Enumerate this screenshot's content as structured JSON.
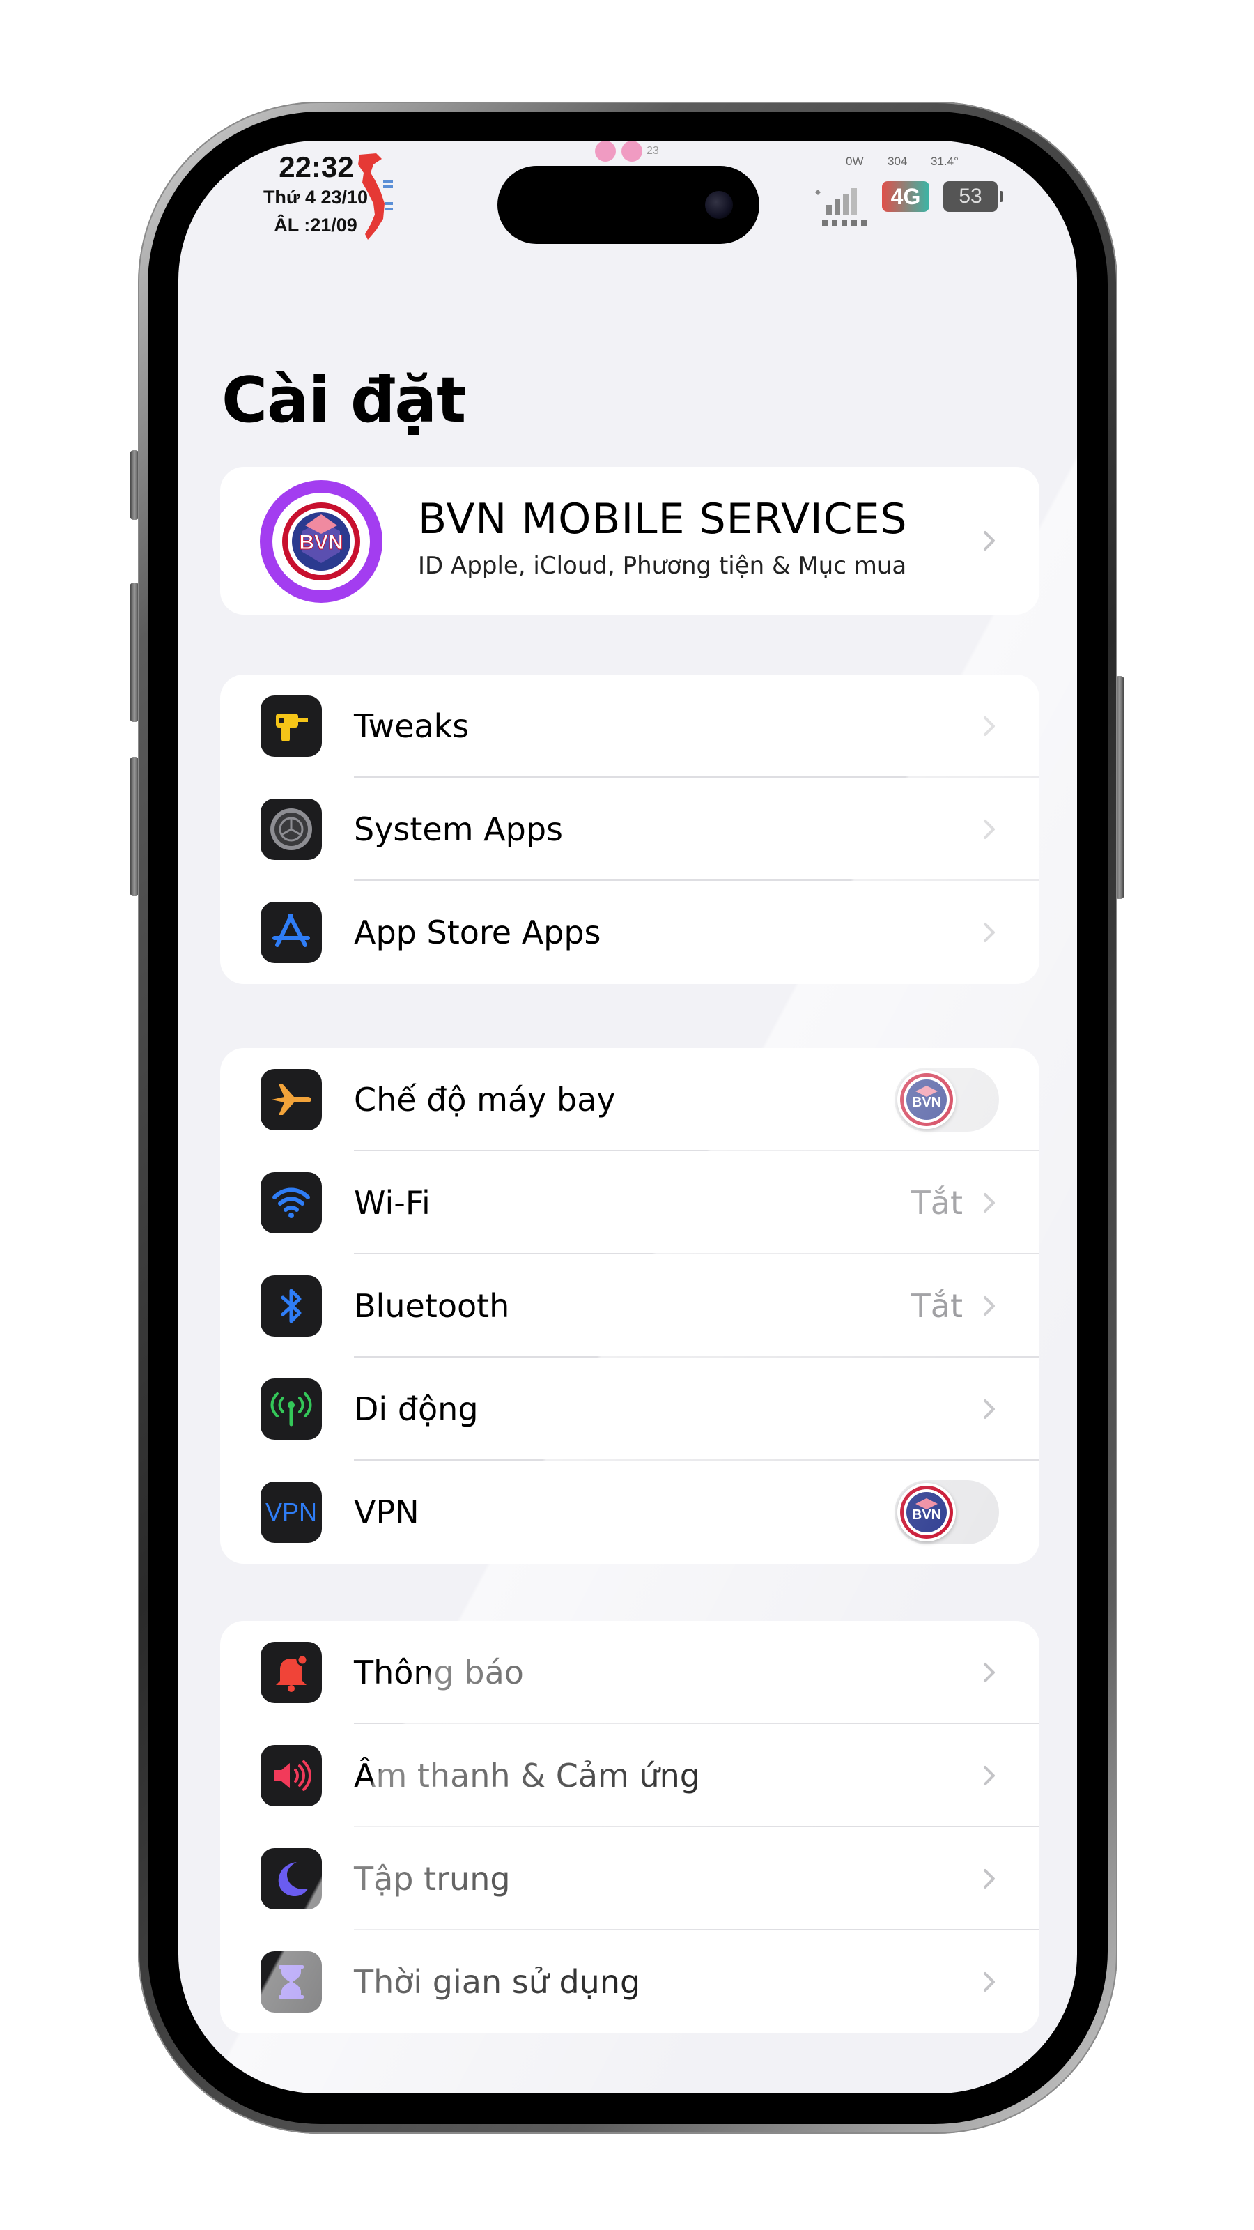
{
  "status_bar": {
    "time": "22:32",
    "date": "Thứ 4 23/10",
    "lunar_date": "ÂL :21/09",
    "volume_level": "23",
    "power": "0W",
    "charge": "304",
    "temperature": "31.4°",
    "network": "4G",
    "battery": "53"
  },
  "page": {
    "title": "Cài đặt"
  },
  "profile": {
    "name": "BVN MOBILE SERVICES",
    "subtitle": "ID Apple, iCloud, Phương tiện & Mục mua",
    "avatar_text": "BVN"
  },
  "groups": [
    {
      "items": [
        {
          "label": "Tweaks",
          "icon": "drill-icon"
        },
        {
          "label": "System Apps",
          "icon": "gear-icon"
        },
        {
          "label": "App Store Apps",
          "icon": "app-store-icon"
        }
      ]
    },
    {
      "items": [
        {
          "label": "Chế độ máy bay",
          "icon": "airplane-icon",
          "toggle": "off",
          "knob_text": "BVN"
        },
        {
          "label": "Wi-Fi",
          "icon": "wifi-icon",
          "value": "Tắt"
        },
        {
          "label": "Bluetooth",
          "icon": "bluetooth-icon",
          "value": "Tắt"
        },
        {
          "label": "Di động",
          "icon": "cellular-icon"
        },
        {
          "label": "VPN",
          "icon": "vpn-icon",
          "icon_text": "VPN",
          "toggle": "off",
          "knob_text": "BVN"
        }
      ]
    },
    {
      "items": [
        {
          "label": "Thông báo",
          "icon": "bell-icon"
        },
        {
          "label": "Âm thanh & Cảm ứng",
          "icon": "speaker-icon"
        },
        {
          "label": "Tập trung",
          "icon": "moon-icon"
        },
        {
          "label": "Thời gian sử dụng",
          "icon": "hourglass-icon"
        }
      ]
    }
  ],
  "colors": {
    "background": "#f2f2f6",
    "airplane": "#f2a33a",
    "wifi": "#2f7df6",
    "bluetooth": "#2f7df6",
    "cellular": "#34c759",
    "vpn": "#2f7df6",
    "notifications": "#f04438",
    "sounds": "#f23a5a",
    "focus": "#6a5cf0",
    "screen_time": "#7a5cf0",
    "tweaks": "#f5c518"
  }
}
